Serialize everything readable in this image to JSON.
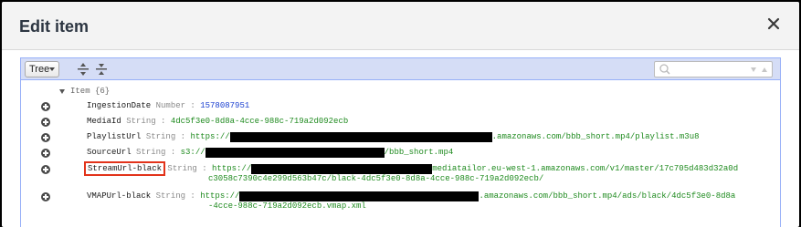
{
  "dialog": {
    "title": "Edit item",
    "close_icon": "close-icon"
  },
  "menu": {
    "mode_label": "Tree",
    "expand_icon": "expand-all-icon",
    "collapse_icon": "collapse-all-icon",
    "search_placeholder": "",
    "search_icon": "search-icon"
  },
  "tree": {
    "root_label": "Item {6}",
    "rows": [
      {
        "key": "IngestionDate",
        "type": "Number",
        "value": "1578087951",
        "kind": "number"
      },
      {
        "key": "MediaId",
        "type": "String",
        "value": "4dc5f3e0-8d8a-4cce-988c-719a2d092ecb",
        "kind": "string"
      },
      {
        "key": "PlaylistUrl",
        "type": "String",
        "value_prefix": "https://",
        "value_suffix": ".amazonaws.com/bbb_short.mp4/playlist.m3u8",
        "kind": "string"
      },
      {
        "key": "SourceUrl",
        "type": "String",
        "value_prefix": "s3://",
        "value_suffix": "/bbb_short.mp4",
        "kind": "string"
      },
      {
        "key": "StreamUrl-black",
        "type": "String",
        "value_prefix": "https://",
        "value_suffix": "mediatailor.eu-west-1.amazonaws.com/v1/master/17c705d483d32a0d",
        "value_line2": "c3058c7390c4e299d563b47c/black-4dc5f3e0-8d8a-4cce-988c-719a2d092ecb/",
        "kind": "string"
      },
      {
        "key": "VMAPUrl-black",
        "type": "String",
        "value_prefix": "https://",
        "value_suffix": ".amazonaws.com/bbb_short.mp4/ads/black/4dc5f3e0-8d8a",
        "value_line2": "-4cce-988c-719a2d092ecb.vmap.xml",
        "kind": "string"
      }
    ]
  }
}
